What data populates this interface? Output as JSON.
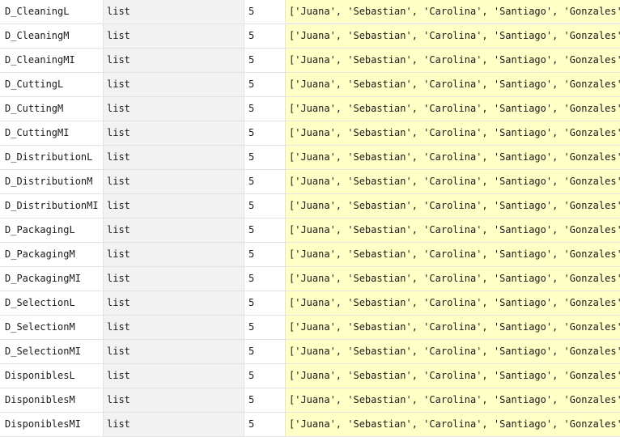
{
  "variables": [
    {
      "name": "D_CleaningL",
      "type": "list",
      "size": "5",
      "value": "['Juana', 'Sebastian', 'Carolina', 'Santiago', 'Gonzales']"
    },
    {
      "name": "D_CleaningM",
      "type": "list",
      "size": "5",
      "value": "['Juana', 'Sebastian', 'Carolina', 'Santiago', 'Gonzales']"
    },
    {
      "name": "D_CleaningMI",
      "type": "list",
      "size": "5",
      "value": "['Juana', 'Sebastian', 'Carolina', 'Santiago', 'Gonzales']"
    },
    {
      "name": "D_CuttingL",
      "type": "list",
      "size": "5",
      "value": "['Juana', 'Sebastian', 'Carolina', 'Santiago', 'Gonzales']"
    },
    {
      "name": "D_CuttingM",
      "type": "list",
      "size": "5",
      "value": "['Juana', 'Sebastian', 'Carolina', 'Santiago', 'Gonzales']"
    },
    {
      "name": "D_CuttingMI",
      "type": "list",
      "size": "5",
      "value": "['Juana', 'Sebastian', 'Carolina', 'Santiago', 'Gonzales']"
    },
    {
      "name": "D_DistributionL",
      "type": "list",
      "size": "5",
      "value": "['Juana', 'Sebastian', 'Carolina', 'Santiago', 'Gonzales']"
    },
    {
      "name": "D_DistributionM",
      "type": "list",
      "size": "5",
      "value": "['Juana', 'Sebastian', 'Carolina', 'Santiago', 'Gonzales']"
    },
    {
      "name": "D_DistributionMI",
      "type": "list",
      "size": "5",
      "value": "['Juana', 'Sebastian', 'Carolina', 'Santiago', 'Gonzales']"
    },
    {
      "name": "D_PackagingL",
      "type": "list",
      "size": "5",
      "value": "['Juana', 'Sebastian', 'Carolina', 'Santiago', 'Gonzales']"
    },
    {
      "name": "D_PackagingM",
      "type": "list",
      "size": "5",
      "value": "['Juana', 'Sebastian', 'Carolina', 'Santiago', 'Gonzales']"
    },
    {
      "name": "D_PackagingMI",
      "type": "list",
      "size": "5",
      "value": "['Juana', 'Sebastian', 'Carolina', 'Santiago', 'Gonzales']"
    },
    {
      "name": "D_SelectionL",
      "type": "list",
      "size": "5",
      "value": "['Juana', 'Sebastian', 'Carolina', 'Santiago', 'Gonzales']"
    },
    {
      "name": "D_SelectionM",
      "type": "list",
      "size": "5",
      "value": "['Juana', 'Sebastian', 'Carolina', 'Santiago', 'Gonzales']"
    },
    {
      "name": "D_SelectionMI",
      "type": "list",
      "size": "5",
      "value": "['Juana', 'Sebastian', 'Carolina', 'Santiago', 'Gonzales']"
    },
    {
      "name": "DisponiblesL",
      "type": "list",
      "size": "5",
      "value": "['Juana', 'Sebastian', 'Carolina', 'Santiago', 'Gonzales']"
    },
    {
      "name": "DisponiblesM",
      "type": "list",
      "size": "5",
      "value": "['Juana', 'Sebastian', 'Carolina', 'Santiago', 'Gonzales']"
    },
    {
      "name": "DisponiblesMI",
      "type": "list",
      "size": "5",
      "value": "['Juana', 'Sebastian', 'Carolina', 'Santiago', 'Gonzales']"
    }
  ],
  "colors": {
    "value_cell_bg": "#ffffc6",
    "type_cell_bg": "#f2f2f2",
    "grid_line": "#e3e3e3"
  }
}
